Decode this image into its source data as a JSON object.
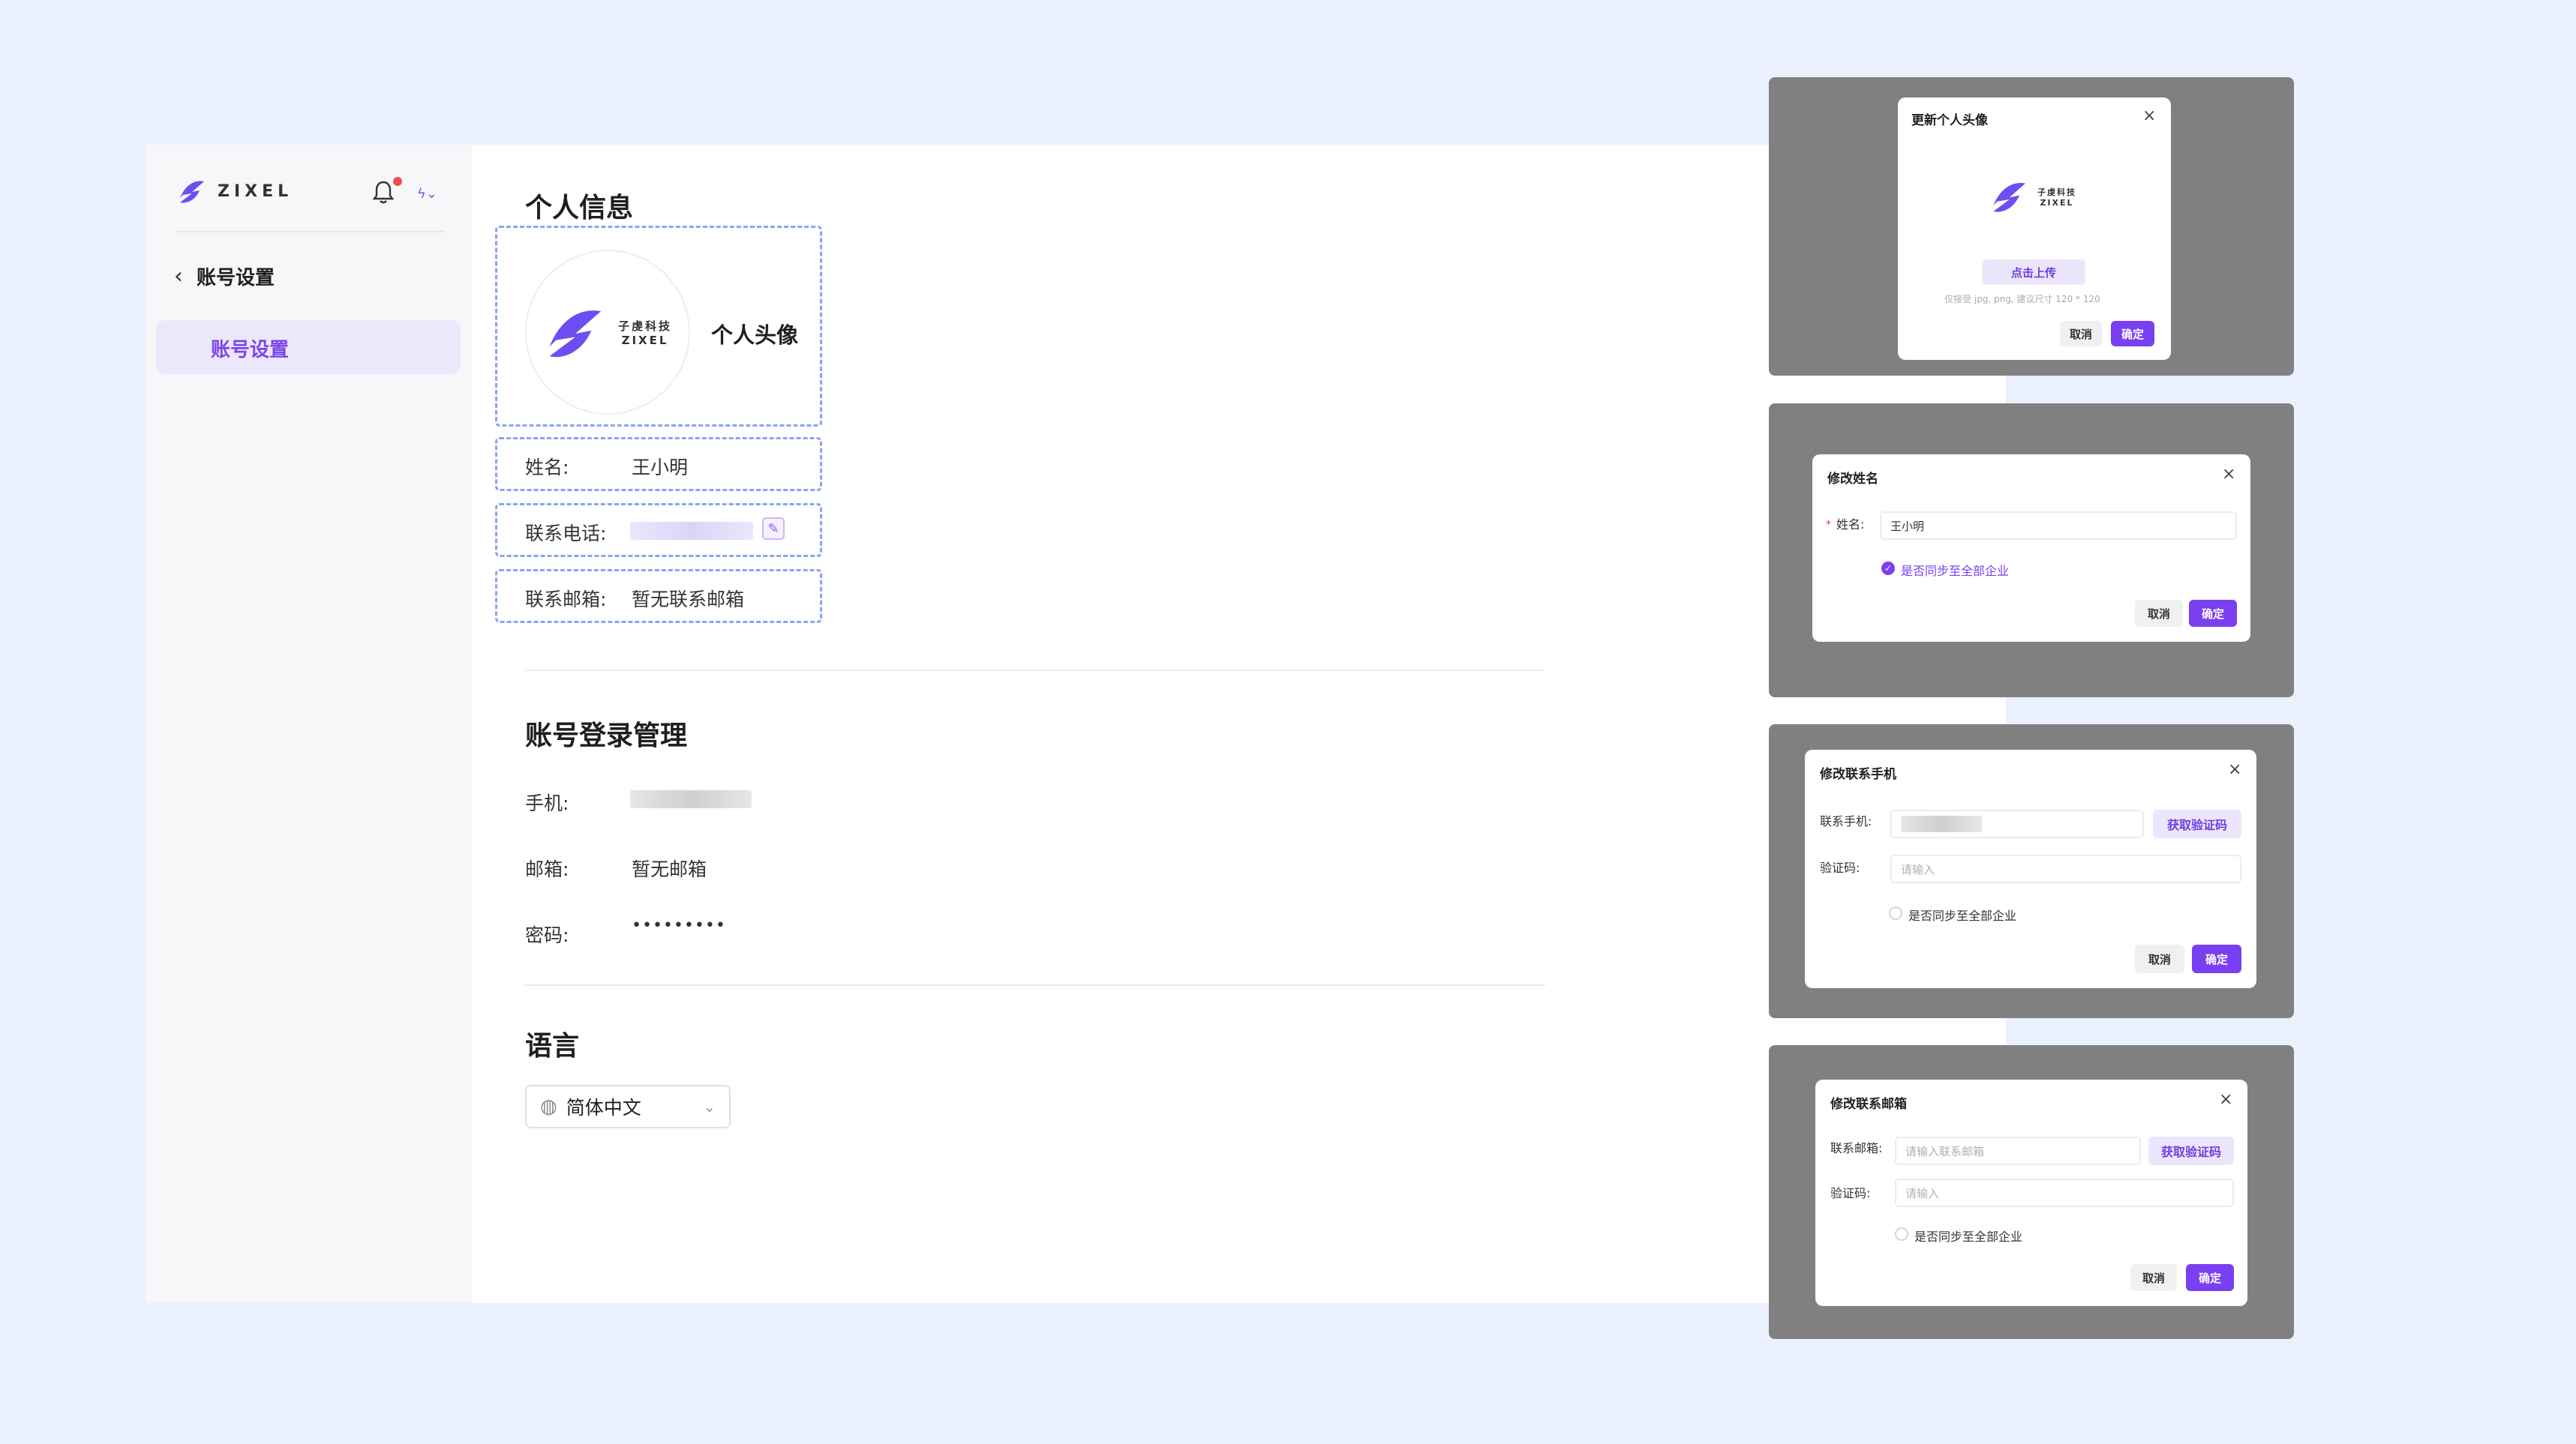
{
  "app": {
    "logo_text": "ZIXEL",
    "nav": {
      "back_label": "账号设置",
      "active_item": "账号设置"
    }
  },
  "profile": {
    "section_title": "个人信息",
    "avatar": {
      "company_cn": "子虔科技",
      "company_en": "ZIXEL",
      "label": "个人头像"
    },
    "name": {
      "label": "姓名:",
      "value": "王小明"
    },
    "phone": {
      "label": "联系电话:"
    },
    "email": {
      "label": "联系邮箱:",
      "value": "暂无联系邮箱"
    }
  },
  "login": {
    "section_title": "账号登录管理",
    "phone_label": "手机:",
    "email_label": "邮箱:",
    "email_value": "暂无邮箱",
    "password_label": "密码:",
    "password_value": "•••••••••"
  },
  "language": {
    "section_title": "语言",
    "selected": "简体中文"
  },
  "dialogs": {
    "avatar": {
      "title": "更新个人头像",
      "logo_cn": "子虔科技",
      "logo_en": "ZIXEL",
      "upload_button": "点击上传",
      "hint": "仅接受 jpg, png,  建议尺寸 120 * 120",
      "cancel": "取消",
      "ok": "确定"
    },
    "name": {
      "title": "修改姓名",
      "field_label": "姓名:",
      "required_mark": "*",
      "value": "王小明",
      "sync_label": "是否同步至全部企业",
      "cancel": "取消",
      "ok": "确定"
    },
    "phone": {
      "title": "修改联系手机",
      "field_label": "联系手机:",
      "code_label": "验证码:",
      "code_placeholder": "请输入",
      "get_code": "获取验证码",
      "sync_label": "是否同步至全部企业",
      "cancel": "取消",
      "ok": "确定"
    },
    "email": {
      "title": "修改联系邮箱",
      "field_label": "联系邮箱:",
      "field_placeholder": "请输入联系邮箱",
      "code_label": "验证码:",
      "code_placeholder": "请输入",
      "get_code": "获取验证码",
      "sync_label": "是否同步至全部企业",
      "cancel": "取消",
      "ok": "确定"
    }
  },
  "colors": {
    "accent": "#7a3ff0",
    "connector": "#8ea3f0",
    "page_bg": "#eaf0fd",
    "overlay": "#808080"
  }
}
